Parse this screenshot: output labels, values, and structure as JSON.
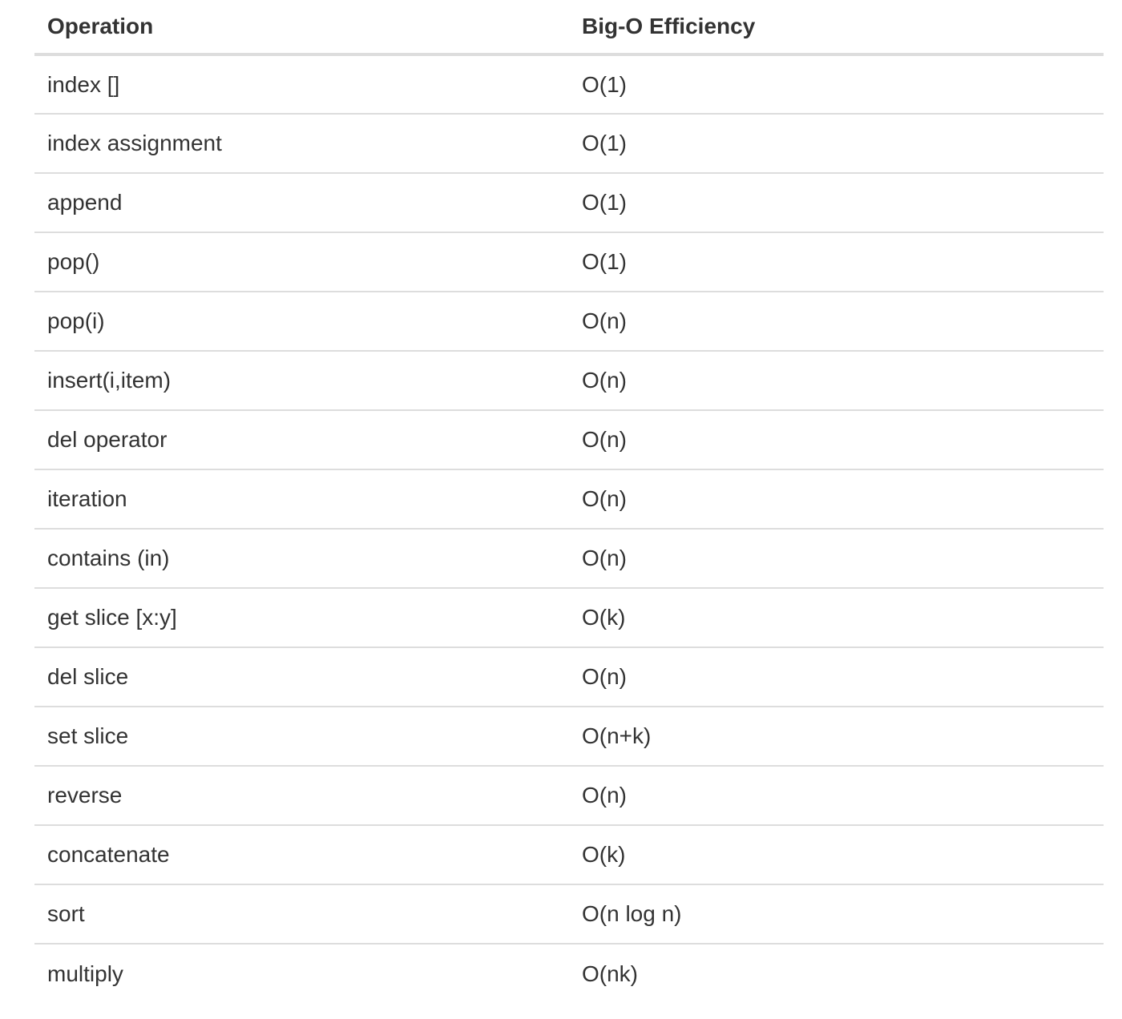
{
  "table": {
    "headers": [
      "Operation",
      "Big-O Efficiency"
    ],
    "rows": [
      [
        "index []",
        "O(1)"
      ],
      [
        "index assignment",
        "O(1)"
      ],
      [
        "append",
        "O(1)"
      ],
      [
        "pop()",
        "O(1)"
      ],
      [
        "pop(i)",
        "O(n)"
      ],
      [
        "insert(i,item)",
        "O(n)"
      ],
      [
        "del operator",
        "O(n)"
      ],
      [
        "iteration",
        "O(n)"
      ],
      [
        "contains (in)",
        "O(n)"
      ],
      [
        "get slice [x:y]",
        "O(k)"
      ],
      [
        "del slice",
        "O(n)"
      ],
      [
        "set slice",
        "O(n+k)"
      ],
      [
        "reverse",
        "O(n)"
      ],
      [
        "concatenate",
        "O(k)"
      ],
      [
        "sort",
        "O(n log n)"
      ],
      [
        "multiply",
        "O(nk)"
      ]
    ]
  }
}
